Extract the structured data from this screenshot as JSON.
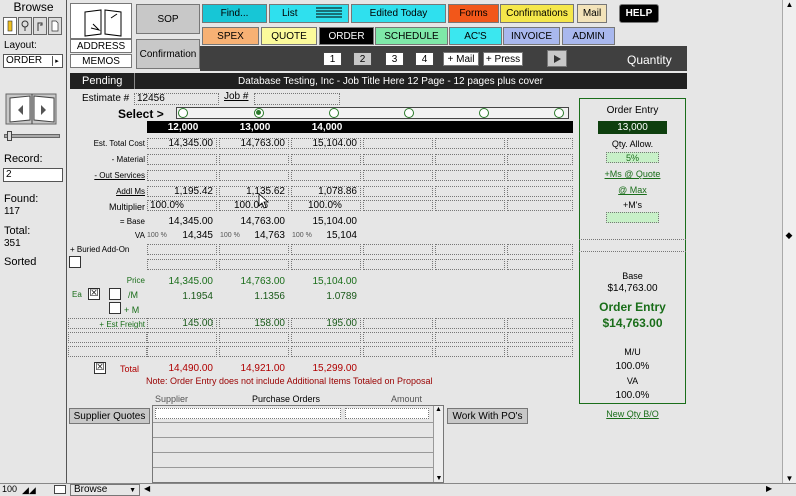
{
  "left": {
    "mode": "Browse",
    "layout_label": "Layout:",
    "layout_value": "ORDER",
    "record_label": "Record:",
    "record_value": "2",
    "found_label": "Found:",
    "found_value": "117",
    "total_label": "Total:",
    "total_value": "351",
    "sorted": "Sorted"
  },
  "bottom": {
    "zoom": "100",
    "mode": "Browse"
  },
  "side": {
    "sop": "SOP",
    "address": "ADDRESS",
    "memos": "MEMOS",
    "confirmation": "Confirmation"
  },
  "nav_row1": [
    {
      "label": "Find...",
      "color": "#17c6d6"
    },
    {
      "label": "List",
      "color": "#2fe0ee"
    },
    {
      "label": "Edited Today",
      "color": "#2fe0ee"
    },
    {
      "label": "Forms",
      "color": "#f2571a"
    },
    {
      "label": "Confirmations",
      "color": "#f5e74a"
    },
    {
      "label": "Mail",
      "color": "#f3e3b9"
    },
    {
      "label": "HELP",
      "color": "#000000"
    }
  ],
  "nav_row2": [
    {
      "label": "SPEX",
      "color": "#f7b174"
    },
    {
      "label": "QUOTE",
      "color": "#fbfa9b"
    },
    {
      "label": "ORDER",
      "color": "#000000"
    },
    {
      "label": "SCHEDULE",
      "color": "#7ee8a8"
    },
    {
      "label": "AC'S",
      "color": "#3be7ef"
    },
    {
      "label": "INVOICE",
      "color": "#a9b8ee"
    },
    {
      "label": "ADMIN",
      "color": "#a9b8ee"
    }
  ],
  "tabs": [
    "1",
    "2",
    "3",
    "4"
  ],
  "plus_mail": "+ Mail",
  "plus_press": "+ Press",
  "quantity_label": "Quantity",
  "pending": "Pending",
  "job_title": "Database Testing, Inc  -  Job Title Here 12 Page  -  12 pages plus cover",
  "estimate_label": "Estimate #",
  "estimate_value": "12456",
  "job_label": "Job #",
  "select_label": "Select >",
  "quantities": [
    "12,000",
    "13,000",
    "14,000",
    "",
    "",
    ""
  ],
  "row_labels": {
    "est_total": "Est. Total Cost",
    "material": "- Material",
    "out_services": "- Out Services",
    "addl": "Addl Ms",
    "multiplier": "Multiplier",
    "base": "= Base",
    "va": "VA",
    "buried": "+ Buried Add-On",
    "price": "Price",
    "per_m": "/M",
    "plus_m": "+ M",
    "ea": "Ea",
    "freight": "+ Est Freight",
    "total": "Total"
  },
  "est_total": [
    "14,345.00",
    "14,763.00",
    "15,104.00"
  ],
  "addl": [
    "1,195.42",
    "1,135.62",
    "1,078.86"
  ],
  "multiplier": [
    "100.0%",
    "100.0%",
    "100.0%"
  ],
  "base": [
    "14,345.00",
    "14,763.00",
    "15,104.00"
  ],
  "va_pct": [
    "100 %",
    "100 %",
    "100 %"
  ],
  "va": [
    "14,345",
    "14,763",
    "15,104"
  ],
  "price": [
    "14,345.00",
    "14,763.00",
    "15,104.00"
  ],
  "per_m": [
    "1.1954",
    "1.1356",
    "1.0789"
  ],
  "freight": [
    "145.00",
    "158.00",
    "195.00"
  ],
  "total": [
    "14,490.00",
    "14,921.00",
    "15,299.00"
  ],
  "note": "Note: Order Entry does not include Additional Items Totaled on Proposal",
  "right": {
    "order_entry": "Order Entry",
    "qty": "13,000",
    "qty_allow": "Qty. Allow.",
    "pct": "5%",
    "ms_quote": "+Ms @ Quote",
    "at_max": "@ Max",
    "plus_ms": "+M's",
    "base_label": "Base",
    "base_value": "$14,763.00",
    "oe_label": "Order Entry",
    "oe_value": "$14,763.00",
    "mu_label": "M/U",
    "mu_value": "100.0%",
    "va_label": "VA",
    "va_value": "100.0%",
    "new_qty": "New Qty B/O"
  },
  "po": {
    "supplier_quotes": "Supplier Quotes",
    "supplier": "Supplier",
    "purchase_orders": "Purchase Orders",
    "amount": "Amount",
    "work_with": "Work With PO's"
  }
}
